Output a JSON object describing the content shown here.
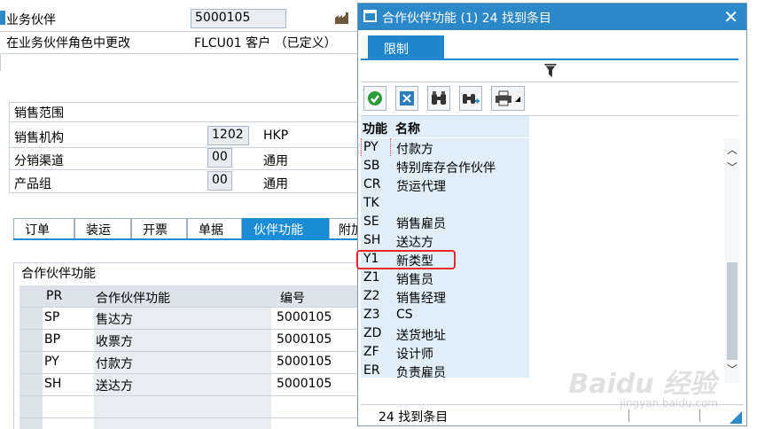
{
  "background": {
    "partner_label": "业务伙伴",
    "partner_value": "5000105",
    "role_label": "在业务伙伴角色中更改",
    "role_value": "FLCU01 客户 （已定义）",
    "sales_area_title": "销售范围",
    "sales_org_label": "销售机构",
    "sales_org_value": "1202",
    "sales_org_desc": "HKP",
    "dist_channel_label": "分销渠道",
    "dist_channel_value": "00",
    "dist_channel_desc": "通用",
    "division_label": "产品组",
    "division_value": "00",
    "division_desc": "通用",
    "tabs": [
      "订单",
      "装运",
      "开票",
      "单据",
      "伙伴功能",
      "附加"
    ],
    "active_tab": "伙伴功能",
    "partner_functions_title": "合作伙伴功能",
    "grid": {
      "columns": [
        "PR",
        "合作伙伴功能",
        "编号"
      ],
      "rows": [
        {
          "code": "SP",
          "name": "售达方",
          "number": "5000105"
        },
        {
          "code": "BP",
          "name": "收票方",
          "number": "5000105"
        },
        {
          "code": "PY",
          "name": "付款方",
          "number": "5000105"
        },
        {
          "code": "SH",
          "name": "送达方",
          "number": "5000105"
        }
      ]
    }
  },
  "popup": {
    "title": "合作伙伴功能 (1)   24 找到条目",
    "restrict_tab": "限制",
    "toolbar": [
      {
        "name": "confirm-button",
        "icon": "check-icon"
      },
      {
        "name": "cancel-button",
        "icon": "cancel-icon"
      },
      {
        "name": "find-button",
        "icon": "binoculars-icon"
      },
      {
        "name": "find-next-button",
        "icon": "binoculars-plus-icon"
      },
      {
        "name": "print-button",
        "icon": "printer-icon"
      }
    ],
    "columns": {
      "code": "功能",
      "name": "名称"
    },
    "items": [
      {
        "code": "PY",
        "name": "付款方"
      },
      {
        "code": "SB",
        "name": "特别库存合作伙伴"
      },
      {
        "code": "CR",
        "name": "货运代理"
      },
      {
        "code": "TK",
        "name": ""
      },
      {
        "code": "SE",
        "name": "销售雇员"
      },
      {
        "code": "SH",
        "name": "送达方"
      },
      {
        "code": "Y1",
        "name": "新类型"
      },
      {
        "code": "Z1",
        "name": "销售员"
      },
      {
        "code": "Z2",
        "name": "销售经理"
      },
      {
        "code": "Z3",
        "name": "CS"
      },
      {
        "code": "ZD",
        "name": "送货地址"
      },
      {
        "code": "ZF",
        "name": "设计师"
      },
      {
        "code": "ER",
        "name": "负责雇员"
      }
    ],
    "highlighted_code": "Y1",
    "status": "24 找到条目"
  },
  "watermark": {
    "brand": "Baidu 经验",
    "url": "jingyan.baidu.com"
  },
  "colors": {
    "accent": "#2c88c8",
    "highlight": "#e8282d",
    "column_bg": "#e1eef8"
  }
}
